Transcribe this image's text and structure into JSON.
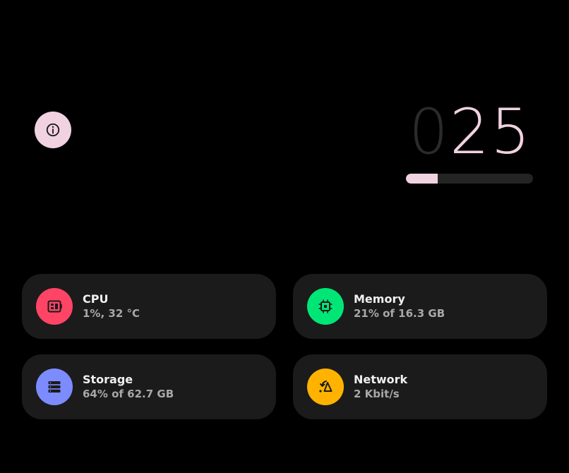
{
  "info_button": {
    "icon": "info-icon",
    "color": "#f1d2e1"
  },
  "counter": {
    "digits": [
      "0",
      "2",
      "5"
    ],
    "dim_digit_count": 1,
    "progress_fraction": 0.25,
    "accent": "#f1d2e1"
  },
  "stats": {
    "cpu": {
      "title": "CPU",
      "value": "1%, 32 °C",
      "icon": "cpu-icon",
      "color": "#ff4466"
    },
    "memory": {
      "title": "Memory",
      "value": "21% of 16.3 GB",
      "icon": "memory-chip-icon",
      "color": "#00e676"
    },
    "storage": {
      "title": "Storage",
      "value": "64% of 62.7 GB",
      "icon": "storage-icon",
      "color": "#7c8cff"
    },
    "network": {
      "title": "Network",
      "value": "2 Kbit/s",
      "icon": "network-icon",
      "color": "#ffb300"
    }
  }
}
